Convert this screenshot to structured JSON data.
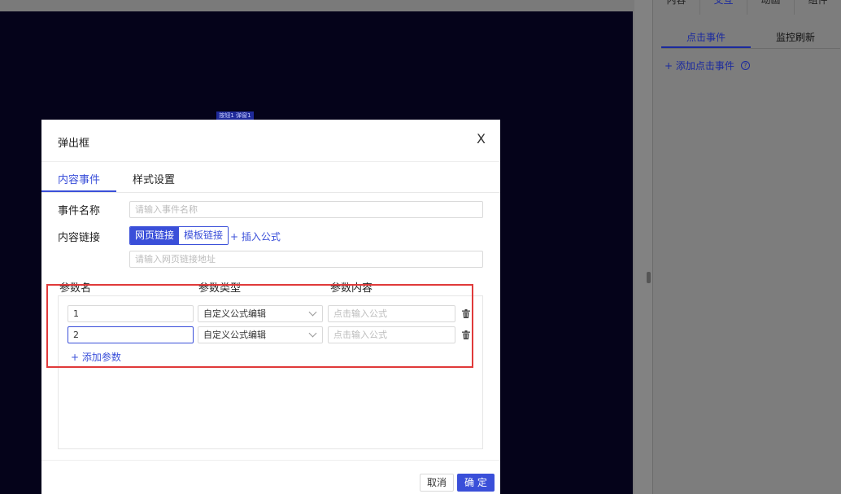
{
  "canvas": {
    "widget_tag": "按钮1 弹窗1"
  },
  "right_panel": {
    "tabs": [
      "内容",
      "交互",
      "动画",
      "组件"
    ],
    "active_tab": "交互",
    "sub_tabs": [
      "点击事件",
      "监控刷新"
    ],
    "add_event_label": "+ 添加点击事件",
    "help_icon": "?"
  },
  "modal": {
    "title": "弹出框",
    "close_label": "X",
    "tabs": [
      "内容事件",
      "样式设置"
    ],
    "event_name_label": "事件名称",
    "event_name_placeholder": "请输入事件名称",
    "content_link_label": "内容链接",
    "link_types": [
      "网页链接",
      "模板链接"
    ],
    "insert_formula": "+ 插入公式",
    "url_placeholder": "请输入网页链接地址",
    "param_headers": [
      "参数名",
      "参数类型",
      "参数内容"
    ],
    "params": [
      {
        "name": "1",
        "type": "自定义公式编辑",
        "content_placeholder": "点击输入公式"
      },
      {
        "name": "2",
        "type": "自定义公式编辑",
        "content_placeholder": "点击输入公式"
      }
    ],
    "add_param": "+ 添加参数",
    "cancel": "取消",
    "ok": "确 定"
  },
  "colors": {
    "accent": "#3a4fd9",
    "highlight": "#e03a3a",
    "canvas_bg": "#05031a"
  }
}
